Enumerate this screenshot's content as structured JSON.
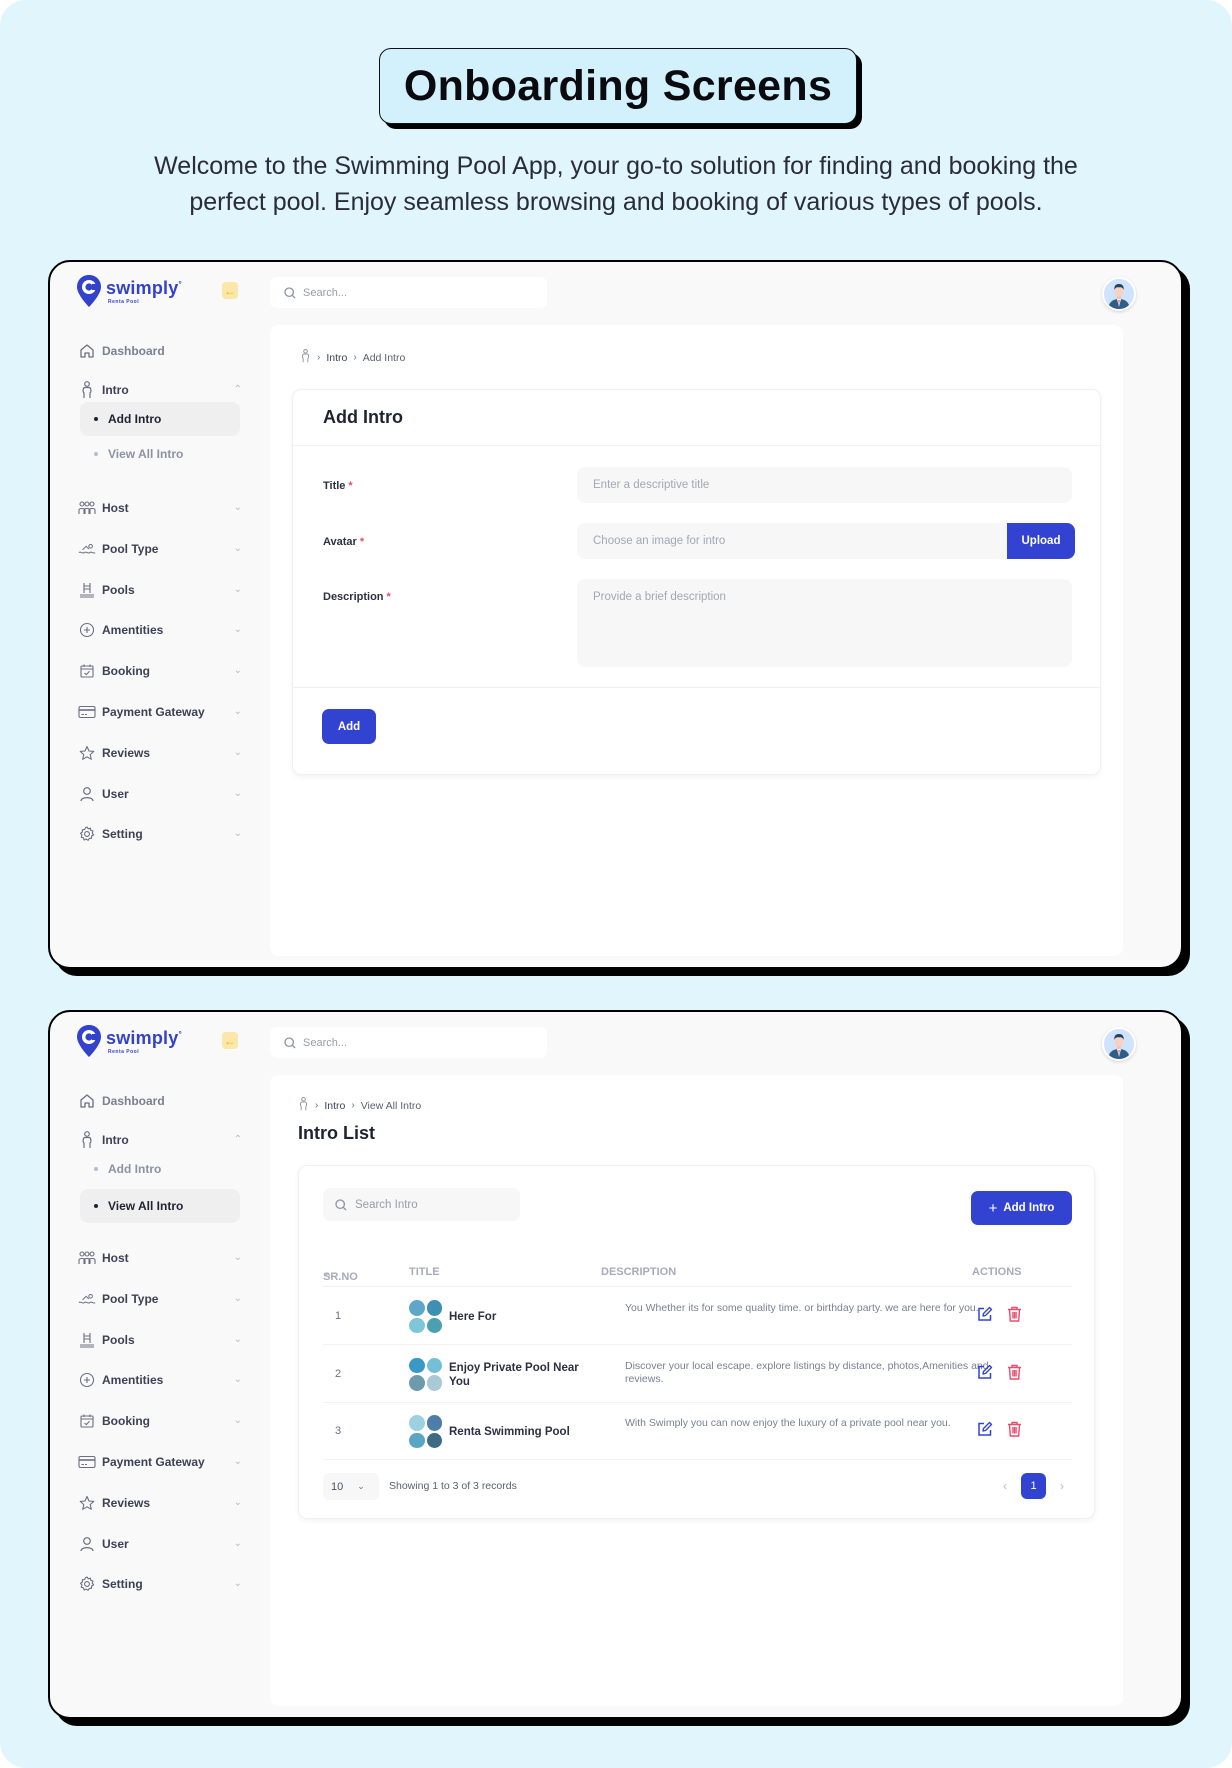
{
  "hero": {
    "title": "Onboarding Screens",
    "subtitle_line1": "Welcome to the Swimming Pool App, your go-to solution for finding and booking the",
    "subtitle_line2": "perfect pool. Enjoy seamless browsing and booking of various types of pools."
  },
  "colors": {
    "brand": "#3343d1",
    "danger": "#e74b6d",
    "background": "#e1f5fd",
    "collapse_accent": "#f0ae14"
  },
  "app": {
    "logo_name": "swimply",
    "logo_tagline": "Renta Pool",
    "search_placeholder": "Search...",
    "avatar_icon": "user-avatar"
  },
  "sidebar": {
    "items": [
      {
        "label": "Dashboard",
        "icon": "home-icon"
      },
      {
        "label": "Intro",
        "icon": "person-icon",
        "expanded": true,
        "children": [
          "Add Intro",
          "View All Intro"
        ]
      },
      {
        "label": "Host",
        "icon": "group-icon"
      },
      {
        "label": "Pool Type",
        "icon": "swimmer-icon"
      },
      {
        "label": "Pools",
        "icon": "pool-ladder-icon"
      },
      {
        "label": "Amentities",
        "icon": "plus-circle-icon"
      },
      {
        "label": "Booking",
        "icon": "calendar-check-icon"
      },
      {
        "label": "Payment Gateway",
        "icon": "credit-card-icon"
      },
      {
        "label": "Reviews",
        "icon": "star-icon"
      },
      {
        "label": "User",
        "icon": "user-icon"
      },
      {
        "label": "Setting",
        "icon": "gear-icon"
      }
    ]
  },
  "screen1": {
    "active_sub": "Add Intro",
    "breadcrumb": [
      "Intro",
      "Add Intro"
    ],
    "form": {
      "title": "Add Intro",
      "fields": [
        {
          "label": "Title",
          "required": true,
          "placeholder": "Enter a descriptive title",
          "value": ""
        },
        {
          "label": "Avatar",
          "required": true,
          "placeholder": "Choose an image for intro",
          "value": ""
        },
        {
          "label": "Description",
          "required": true,
          "placeholder": "Provide a brief description",
          "value": ""
        }
      ],
      "upload_label": "Upload",
      "submit_label": "Add"
    }
  },
  "screen2": {
    "active_sub": "View All Intro",
    "breadcrumb": [
      "Intro",
      "View All Intro"
    ],
    "page_title": "Intro List",
    "search_placeholder": "Search Intro",
    "add_button_label": "Add Intro",
    "columns": [
      "SR.NO",
      "TITLE",
      "DESCRIPTION",
      "ACTIONS"
    ],
    "sort_column": "SR.NO",
    "rows": [
      {
        "sr": "1",
        "title": "Here For",
        "description": "You Whether its for some quality time. or birthday party. we are here for you."
      },
      {
        "sr": "2",
        "title": "Enjoy Private Pool Near You",
        "description": "Discover your local escape. explore listings by distance, photos,Amenities and reviews."
      },
      {
        "sr": "3",
        "title": "Renta Swimming Pool",
        "description": "With Swimply you can now enjoy the luxury of a private pool near you."
      }
    ],
    "page_size": "10",
    "showing_text": "Showing 1 to 3 of 3 records",
    "current_page": "1"
  }
}
